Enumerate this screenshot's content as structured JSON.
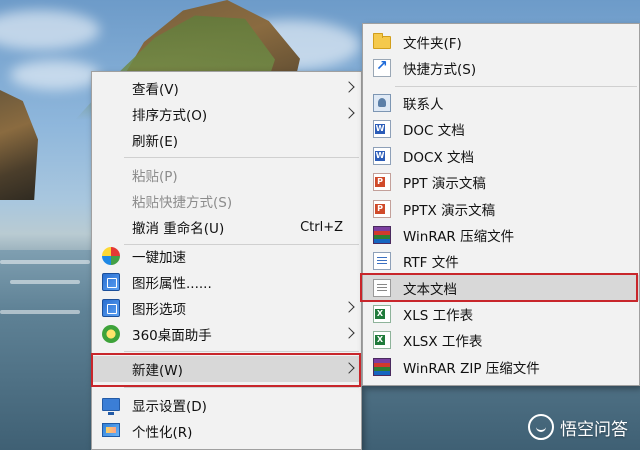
{
  "primary_menu": {
    "items": [
      {
        "label": "查看(V)",
        "submenu": true
      },
      {
        "label": "排序方式(O)",
        "submenu": true
      },
      {
        "label": "刷新(E)"
      },
      {
        "label": "粘贴(P)",
        "disabled": true
      },
      {
        "label": "粘贴快捷方式(S)",
        "disabled": true
      },
      {
        "label": "撤消 重命名(U)",
        "shortcut": "Ctrl+Z"
      },
      {
        "label": "一键加速",
        "icon": "speed-boost-icon"
      },
      {
        "label": "图形属性......",
        "icon": "graphics-properties-icon"
      },
      {
        "label": "图形选项",
        "icon": "graphics-options-icon",
        "submenu": true
      },
      {
        "label": "360桌面助手",
        "icon": "360-desktop-icon",
        "submenu": true
      },
      {
        "label": "新建(W)",
        "submenu": true,
        "highlighted": true
      },
      {
        "label": "显示设置(D)",
        "icon": "display-settings-icon"
      },
      {
        "label": "个性化(R)",
        "icon": "personalize-icon"
      }
    ]
  },
  "new_submenu": {
    "items": [
      {
        "label": "文件夹(F)",
        "icon": "folder-icon"
      },
      {
        "label": "快捷方式(S)",
        "icon": "shortcut-icon"
      },
      {
        "label": "联系人",
        "icon": "contact-icon"
      },
      {
        "label": "DOC 文档",
        "icon": "word-doc-icon"
      },
      {
        "label": "DOCX 文档",
        "icon": "word-docx-icon"
      },
      {
        "label": "PPT 演示文稿",
        "icon": "ppt-icon"
      },
      {
        "label": "PPTX 演示文稿",
        "icon": "pptx-icon"
      },
      {
        "label": "WinRAR 压缩文件",
        "icon": "winrar-icon"
      },
      {
        "label": "RTF 文件",
        "icon": "rtf-icon"
      },
      {
        "label": "文本文档",
        "icon": "text-document-icon",
        "highlighted": true
      },
      {
        "label": "XLS 工作表",
        "icon": "xls-icon"
      },
      {
        "label": "XLSX 工作表",
        "icon": "xlsx-icon"
      },
      {
        "label": "WinRAR ZIP 压缩文件",
        "icon": "winrar-zip-icon"
      }
    ]
  },
  "watermark": {
    "text": "悟空问答"
  },
  "colors": {
    "highlight_border": "#c8262b",
    "menu_bg": "#f2f2f2",
    "hover_bg": "#d8d8d8"
  }
}
